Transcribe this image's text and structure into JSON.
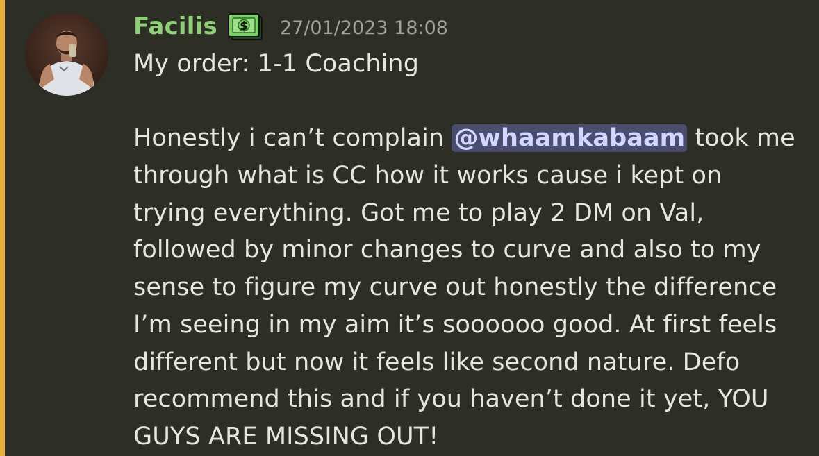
{
  "message": {
    "author": "Facilis",
    "role_icon": "dollar-bill-icon",
    "timestamp": "27/01/2023 18:08",
    "order_line": "My order: 1-1 Coaching",
    "body": {
      "line1_before": "Honestly i can’t complain ",
      "mention": "@whaamkabaam",
      "line1_after": " took me",
      "line2": "through what is CC how it works cause i kept on",
      "line3": "trying everything. Got me to play 2 DM on Val,",
      "line4": "followed by minor changes to curve and also to my",
      "line5": "sense to figure my curve out honestly the difference",
      "line6": "I’m seeing in my aim it’s soooooo good. At first feels",
      "line7": "different but now it feels like second nature. Defo",
      "line8": "recommend this and if you haven’t done it yet, YOU",
      "line9": "GUYS ARE MISSING OUT!"
    }
  },
  "colors": {
    "background": "#2d2e25",
    "mention_bar": "#e8b23a",
    "username": "#8fcf78",
    "timestamp": "#a3a39a",
    "text": "#e6e5df",
    "mention_bg": "#4a4d6e",
    "mention_text": "#d3d7ff"
  }
}
